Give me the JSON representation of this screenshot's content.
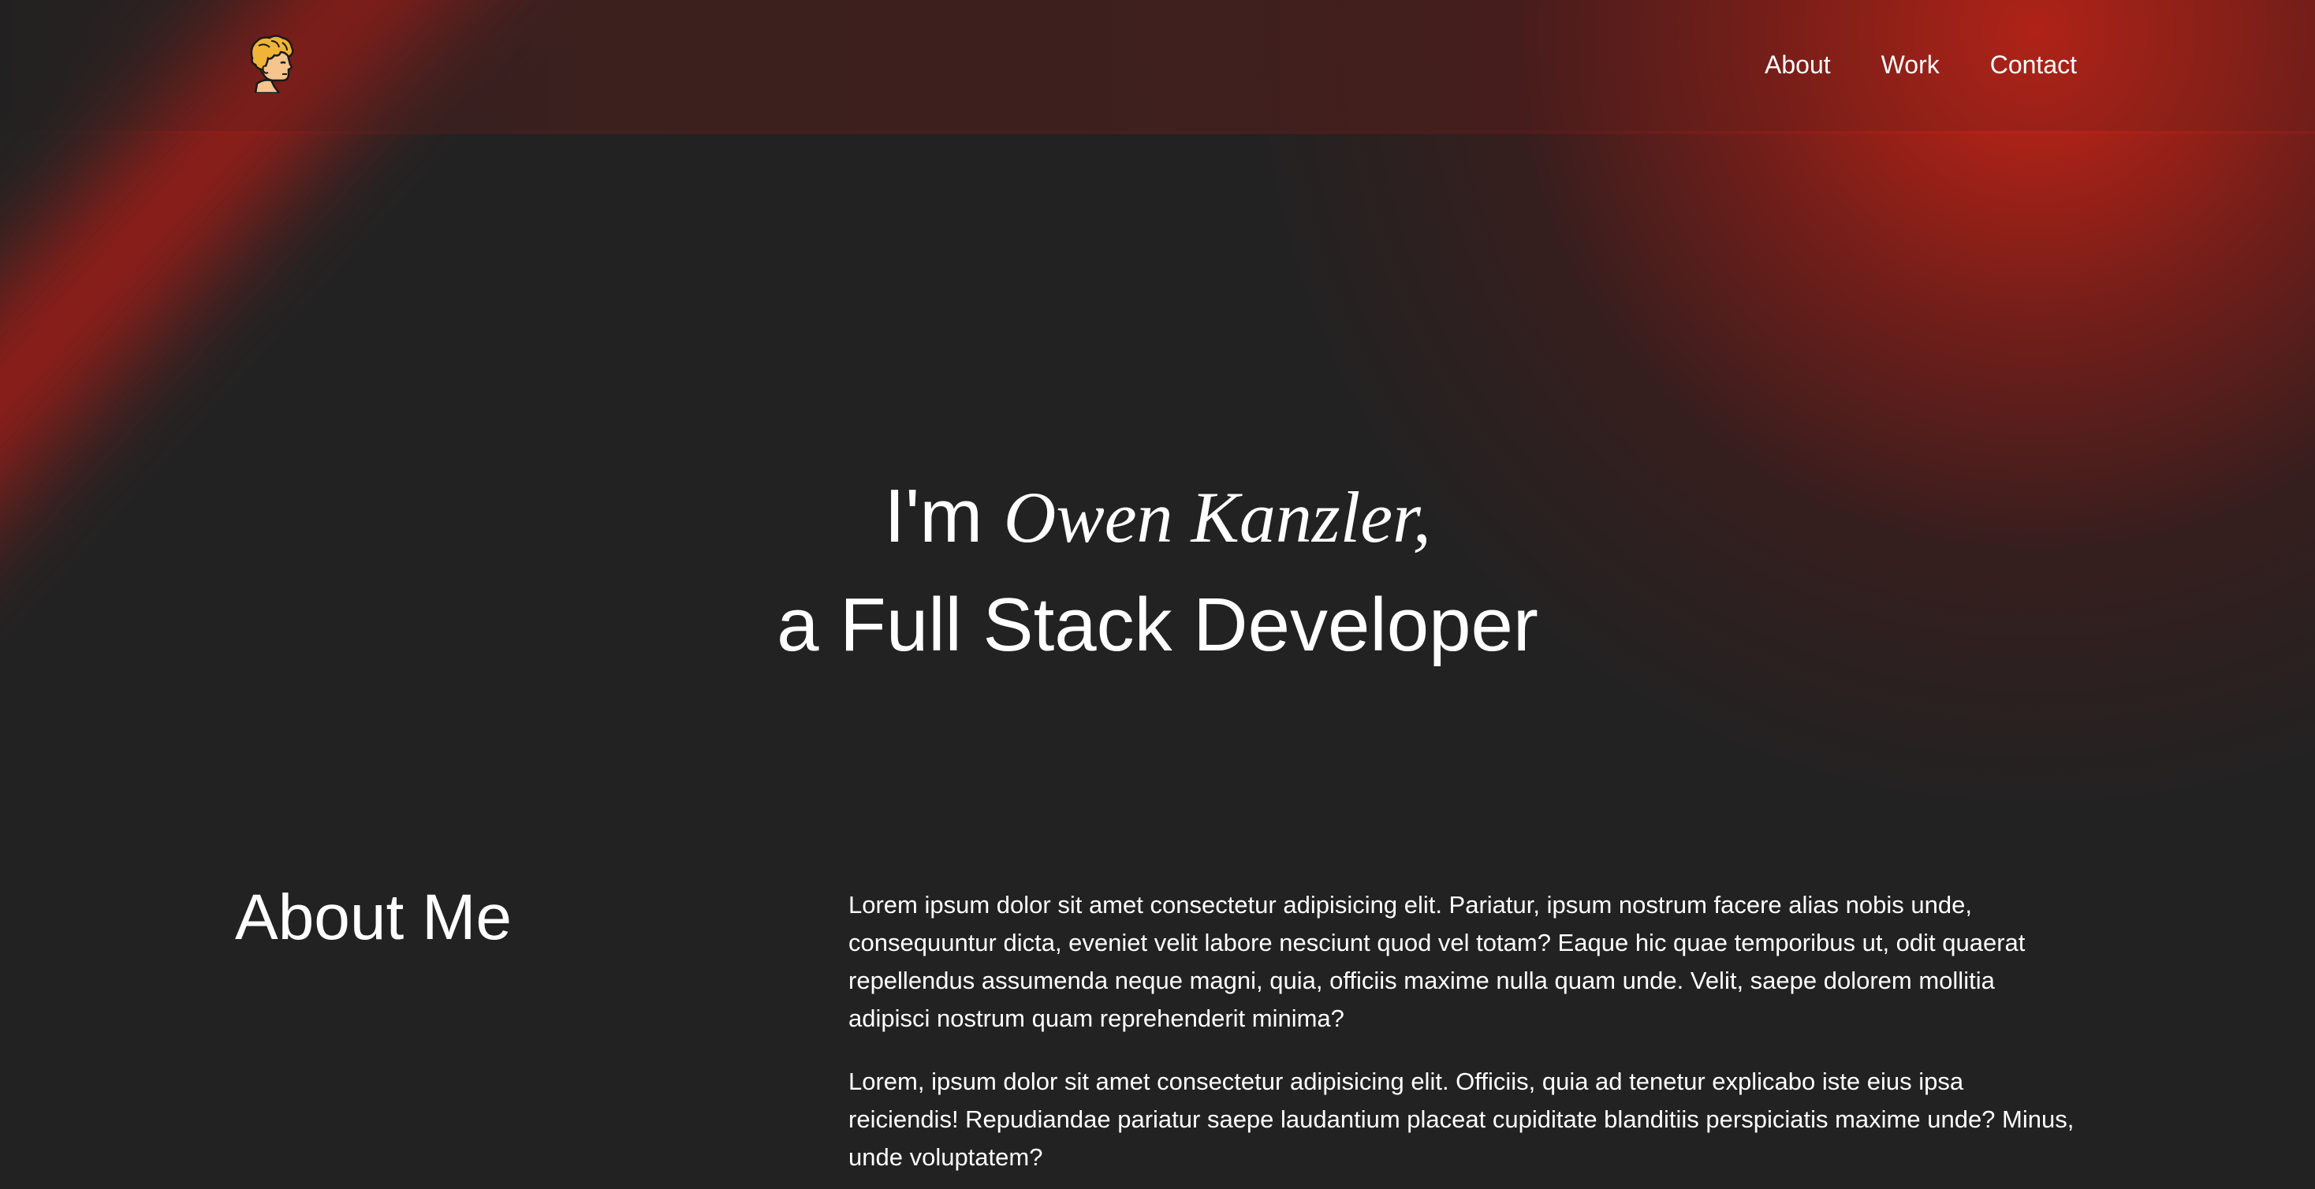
{
  "header": {
    "logo_icon": "cartoon-avatar-icon",
    "nav": [
      {
        "label": "About"
      },
      {
        "label": "Work"
      },
      {
        "label": "Contact"
      }
    ]
  },
  "hero": {
    "intro": "I'm",
    "name": "Owen Kanzler,",
    "tagline": "a Full Stack Developer"
  },
  "about": {
    "title": "About Me",
    "paragraphs": [
      "Lorem ipsum dolor sit amet consectetur adipisicing elit. Pariatur, ipsum nostrum facere alias nobis unde, consequuntur dicta, eveniet velit labore nesciunt quod vel totam? Eaque hic quae temporibus ut, odit quaerat repellendus assumenda neque magni, quia, officiis maxime nulla quam unde. Velit, saepe dolorem mollitia adipisci nostrum quam reprehenderit minima?",
      "Lorem, ipsum dolor sit amet consectetur adipisicing elit. Officiis, quia ad tenetur explicabo iste eius ipsa reiciendis! Repudiandae pariatur saepe laudantium placeat cupiditate blanditiis perspiciatis maxime unde? Minus, unde voluptatem?"
    ]
  },
  "colors": {
    "background": "#222222",
    "accent_glow": "#c81e14",
    "text": "#ffffff",
    "logo_hair": "#f2b437",
    "logo_skin": "#f6c58e"
  }
}
